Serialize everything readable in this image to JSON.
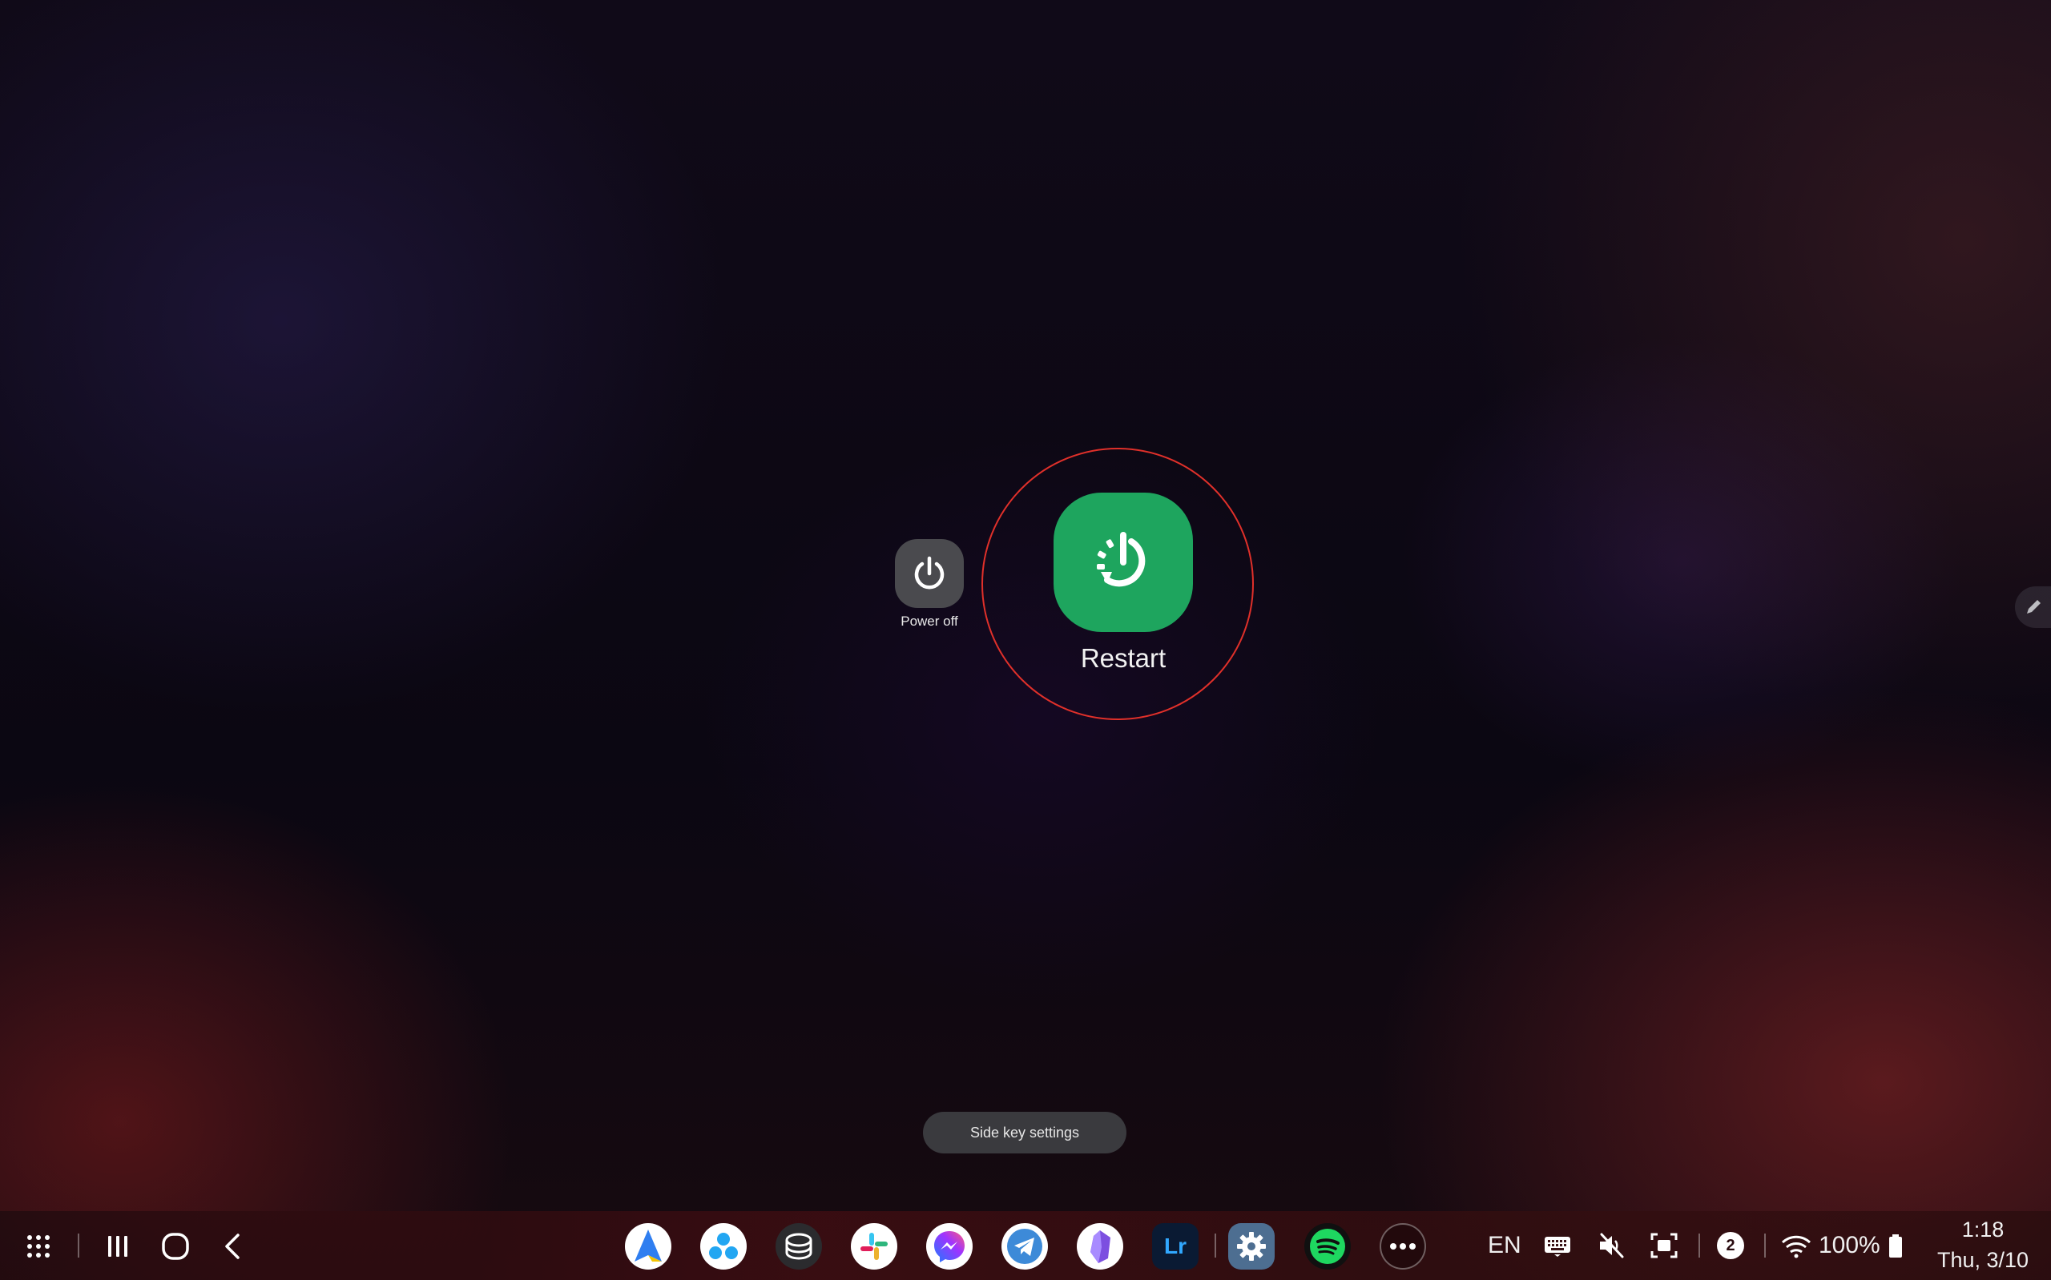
{
  "power_menu": {
    "power_off_label": "Power off",
    "restart_label": "Restart",
    "side_key_label": "Side key settings"
  },
  "colors": {
    "restart_green": "#1ea55e",
    "power_off_gray": "#4a4a4e",
    "highlight_red": "#e0302a"
  },
  "taskbar": {
    "nav": [
      "apps-grid-icon",
      "recents-icon",
      "home-icon",
      "back-icon"
    ],
    "apps": [
      {
        "name": "spark-mail",
        "icon": "paper-plane-icon"
      },
      {
        "name": "bubbles-app",
        "icon": "bubbles-icon"
      },
      {
        "name": "samsung-wallet",
        "icon": "wallet-icon"
      },
      {
        "name": "slack",
        "icon": "slack-icon"
      },
      {
        "name": "messenger",
        "icon": "messenger-icon"
      },
      {
        "name": "telegram",
        "icon": "telegram-icon"
      },
      {
        "name": "obsidian",
        "icon": "obsidian-icon"
      },
      {
        "name": "lightroom",
        "icon": "lightroom-icon",
        "text": "Lr"
      },
      {
        "name": "settings",
        "icon": "gear-icon"
      },
      {
        "name": "spotify",
        "icon": "spotify-icon"
      }
    ],
    "more_apps_icon": "more-icon"
  },
  "status": {
    "language": "EN",
    "notification_count": "2",
    "battery": "100%",
    "time": "1:18",
    "date": "Thu, 3/10"
  }
}
